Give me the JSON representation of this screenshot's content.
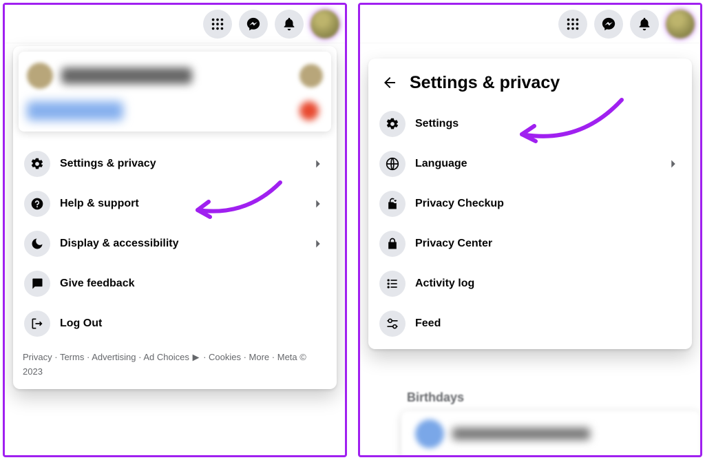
{
  "accent": "#a020f0",
  "top_icons": [
    "apps-icon",
    "messenger-icon",
    "bell-icon",
    "avatar-icon"
  ],
  "left": {
    "menu": [
      {
        "icon": "gear-icon",
        "label": "Settings & privacy",
        "chevron": true
      },
      {
        "icon": "question-icon",
        "label": "Help & support",
        "chevron": true
      },
      {
        "icon": "moon-icon",
        "label": "Display & accessibility",
        "chevron": true
      },
      {
        "icon": "feedback-icon",
        "label": "Give feedback",
        "chevron": false
      },
      {
        "icon": "logout-icon",
        "label": "Log Out",
        "chevron": false
      }
    ],
    "footer": {
      "links": [
        "Privacy",
        "Terms",
        "Advertising",
        "Ad Choices",
        "Cookies",
        "More"
      ],
      "copyright": "Meta © 2023"
    }
  },
  "right": {
    "title": "Settings & privacy",
    "items": [
      {
        "icon": "gear-icon",
        "label": "Settings",
        "chevron": false
      },
      {
        "icon": "globe-icon",
        "label": "Language",
        "chevron": true
      },
      {
        "icon": "lock-heart-icon",
        "label": "Privacy Checkup",
        "chevron": false
      },
      {
        "icon": "lock-icon",
        "label": "Privacy Center",
        "chevron": false
      },
      {
        "icon": "list-icon",
        "label": "Activity log",
        "chevron": false
      },
      {
        "icon": "sliders-icon",
        "label": "Feed",
        "chevron": false
      }
    ],
    "bg_label": "Birthdays"
  }
}
